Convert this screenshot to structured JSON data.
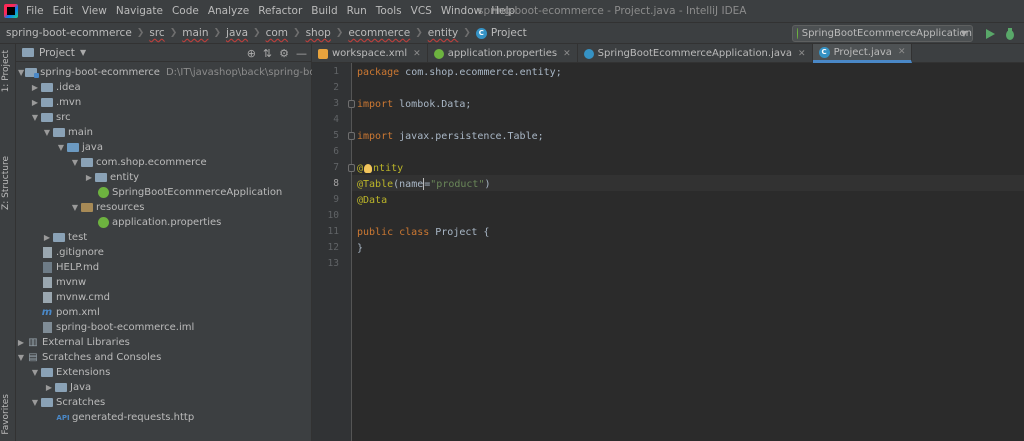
{
  "menubar": {
    "items": [
      "File",
      "Edit",
      "View",
      "Navigate",
      "Code",
      "Analyze",
      "Refactor",
      "Build",
      "Run",
      "Tools",
      "VCS",
      "Window",
      "Help"
    ],
    "window_title": "spring-boot-ecommerce - Project.java - IntelliJ IDEA"
  },
  "navbar": {
    "breadcrumbs": [
      "spring-boot-ecommerce",
      "src",
      "main",
      "java",
      "com",
      "shop",
      "ecommerce",
      "entity",
      "Project"
    ],
    "run_config": "SpringBootEcommerceApplication"
  },
  "left_strip": {
    "tab_project": "1: Project",
    "tab_structure": "Z: Structure",
    "tab_favorites": "Favorites"
  },
  "project_panel": {
    "title": "Project",
    "tree": [
      {
        "label": "spring-boot-ecommerce",
        "path": "D:\\IT\\javashop\\back\\spring-boot-eco",
        "icon": "module-folder-icon",
        "expanded": true
      },
      {
        "label": ".idea",
        "icon": "folder-icon",
        "expanded": false
      },
      {
        "label": ".mvn",
        "icon": "folder-icon",
        "expanded": false
      },
      {
        "label": "src",
        "icon": "folder-icon",
        "expanded": true
      },
      {
        "label": "main",
        "icon": "folder-icon",
        "expanded": true
      },
      {
        "label": "java",
        "icon": "source-folder-icon",
        "expanded": true
      },
      {
        "label": "com.shop.ecommerce",
        "icon": "package-icon",
        "expanded": true
      },
      {
        "label": "entity",
        "icon": "package-icon",
        "expanded": false
      },
      {
        "label": "SpringBootEcommerceApplication",
        "icon": "spring-class-icon"
      },
      {
        "label": "resources",
        "icon": "resources-folder-icon",
        "expanded": true
      },
      {
        "label": "application.properties",
        "icon": "spring-properties-icon"
      },
      {
        "label": "test",
        "icon": "folder-icon",
        "expanded": false
      },
      {
        "label": ".gitignore",
        "icon": "file-icon"
      },
      {
        "label": "HELP.md",
        "icon": "markdown-icon"
      },
      {
        "label": "mvnw",
        "icon": "file-icon"
      },
      {
        "label": "mvnw.cmd",
        "icon": "file-icon"
      },
      {
        "label": "pom.xml",
        "icon": "maven-icon"
      },
      {
        "label": "spring-boot-ecommerce.iml",
        "icon": "iml-icon"
      },
      {
        "label": "External Libraries",
        "icon": "library-icon",
        "expanded": false
      },
      {
        "label": "Scratches and Consoles",
        "icon": "scratches-icon",
        "expanded": true
      },
      {
        "label": "Extensions",
        "icon": "folder-icon",
        "expanded": true
      },
      {
        "label": "Java",
        "icon": "folder-icon",
        "expanded": false
      },
      {
        "label": "Scratches",
        "icon": "folder-icon",
        "expanded": true
      },
      {
        "label": "generated-requests.http",
        "icon": "http-icon"
      }
    ]
  },
  "editor": {
    "tabs": [
      {
        "label": "workspace.xml",
        "icon": "xml-icon"
      },
      {
        "label": "application.properties",
        "icon": "spring-properties-icon"
      },
      {
        "label": "SpringBootEcommerceApplication.java",
        "icon": "spring-class-icon"
      },
      {
        "label": "Project.java",
        "icon": "class-icon",
        "active": true
      }
    ],
    "line_numbers": [
      "1",
      "2",
      "3",
      "4",
      "5",
      "6",
      "7",
      "8",
      "9",
      "10",
      "11",
      "12",
      "13"
    ],
    "current_line": 8,
    "code": {
      "l1_kw": "package",
      "l1_rest": " com.shop.ecommerce.entity;",
      "l3_kw": "import",
      "l3_rest": " lombok.Data;",
      "l5_kw": "import",
      "l5_rest": " javax.persistence.Table;",
      "l7_a": "@",
      "l7_b": "ntity",
      "l8_ann": "@Table",
      "l8_p1": "(",
      "l8_name": "name",
      "l8_eq": "=",
      "l8_str": "\"product\"",
      "l8_p2": ")",
      "l9_ann": "@Data",
      "l11_kw": "public class",
      "l11_rest": " Project {",
      "l12": "}"
    }
  },
  "colors": {
    "background": "#2b2b2b",
    "panel": "#3c3f41",
    "keyword": "#cc7832",
    "annotation": "#bbb529",
    "string": "#6a8759",
    "accent": "#4a88c7"
  }
}
